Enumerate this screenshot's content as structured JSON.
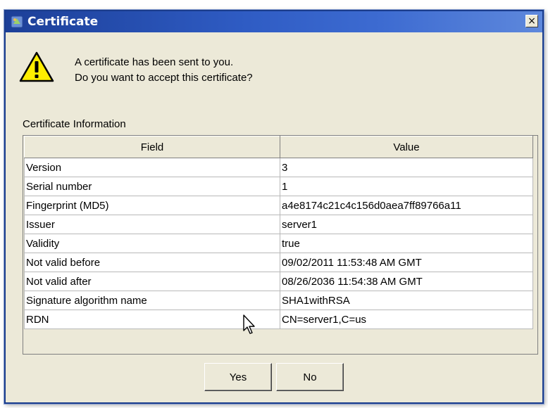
{
  "window": {
    "title": "Certificate",
    "close_glyph": "×"
  },
  "message": {
    "line1": "A certificate has been sent to you.",
    "line2": "Do you want to accept this certificate?"
  },
  "info_label": "Certificate Information",
  "table": {
    "headers": [
      "Field",
      "Value"
    ],
    "rows": [
      [
        "Version",
        "3"
      ],
      [
        "Serial number",
        "1"
      ],
      [
        "Fingerprint (MD5)",
        "a4e8174c21c4c156d0aea7ff89766a11"
      ],
      [
        "Issuer",
        "server1"
      ],
      [
        "Validity",
        "true"
      ],
      [
        "Not valid before",
        "09/02/2011 11:53:48 AM GMT"
      ],
      [
        "Not valid after",
        "08/26/2036 11:54:38 AM GMT"
      ],
      [
        "Signature algorithm name",
        "SHA1withRSA"
      ],
      [
        "RDN",
        "CN=server1,C=us"
      ]
    ]
  },
  "buttons": {
    "yes": "Yes",
    "no": "No"
  },
  "icons": {
    "app": "java-app-icon",
    "warning": "warning-triangle-icon",
    "cursor": "mouse-pointer-icon"
  },
  "colors": {
    "titlebar_start": "#1c3f98",
    "titlebar_end": "#5e88dc",
    "dialog_bg": "#ece9d8",
    "warning_fill": "#ffee00"
  }
}
